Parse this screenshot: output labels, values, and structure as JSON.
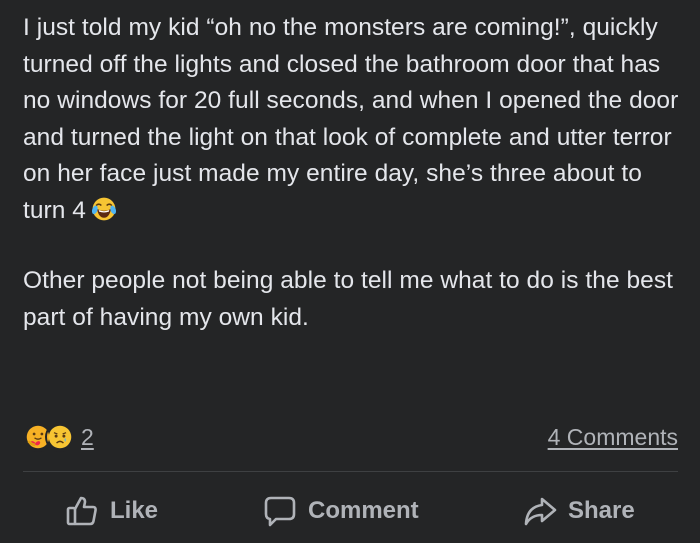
{
  "post": {
    "paragraph_1": "I just told my kid “oh no the monsters are coming!”, quickly turned off the lights and closed the bathroom door that has no windows for 20 full seconds, and when I opened the door and turned the light on that look of complete and utter terror on her face just made my entire day, she’s three about to turn 4",
    "paragraph_1_emoji": "tears-of-joy-emoji",
    "paragraph_2": "Other people not being able to tell me what to do is the best part of having my own kid."
  },
  "stats": {
    "reactions": [
      "care-reaction-icon",
      "sad-reaction-icon"
    ],
    "reaction_count": "2",
    "comments_label": "4 Comments"
  },
  "actions": {
    "like_label": "Like",
    "like_icon": "thumbs-up-icon",
    "comment_label": "Comment",
    "comment_icon": "speech-bubble-icon",
    "share_label": "Share",
    "share_icon": "share-arrow-icon"
  },
  "colors": {
    "background": "#242526",
    "text_primary": "#e4e6eb",
    "text_secondary": "#b0b3b8",
    "divider": "#3e4042"
  }
}
